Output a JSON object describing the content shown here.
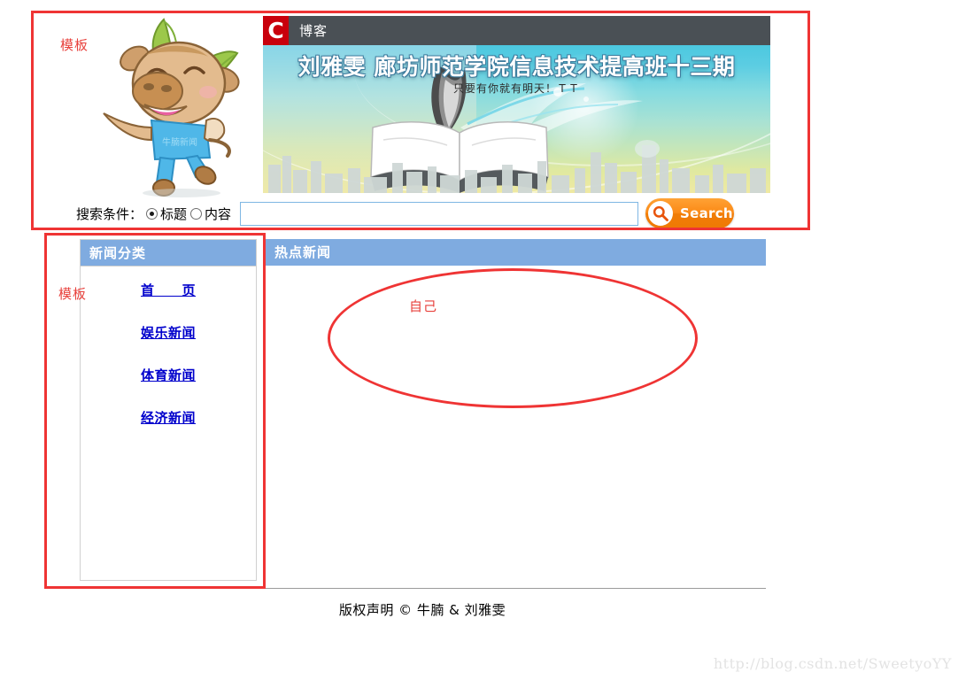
{
  "annotations": {
    "template_label_top": "模板",
    "template_label_sidebar": "模板",
    "own_label": "自己"
  },
  "banner": {
    "logo_mark": "C",
    "topbar_title": "博客",
    "title": "刘雅雯 廊坊师范学院信息技术提高班十三期",
    "subtitle": "只要有你就有明天！ＴＴ",
    "mascot_icon": "cow-mascot-icon",
    "book_icon": "open-book-icon",
    "quill_icon": "feather-quill-icon",
    "city_icon": "city-skyline-icon"
  },
  "search": {
    "label": "搜索条件：",
    "options": [
      {
        "label": "标题",
        "checked": true
      },
      {
        "label": "内容",
        "checked": false
      }
    ],
    "input_value": "",
    "input_placeholder": "",
    "button_label": "Search",
    "button_icon": "magnifier-icon"
  },
  "sidebar": {
    "title": "新闻分类",
    "links": [
      {
        "label": "首　　页"
      },
      {
        "label": "娱乐新闻"
      },
      {
        "label": "体育新闻"
      },
      {
        "label": "经济新闻"
      }
    ]
  },
  "news": {
    "title": "热点新闻",
    "items": []
  },
  "footer": {
    "copyright": "版权声明 © 牛腩 & 刘雅雯"
  },
  "watermark": {
    "text": "http://blog.csdn.net/SweetyoYY"
  },
  "colors": {
    "annotation_red": "#ef3434",
    "panel_header_blue": "#7fabe0",
    "link_blue": "#0000cc",
    "search_orange": "#fb8a16",
    "topbar_dark": "#4a5055",
    "logo_red": "#c9000c"
  }
}
